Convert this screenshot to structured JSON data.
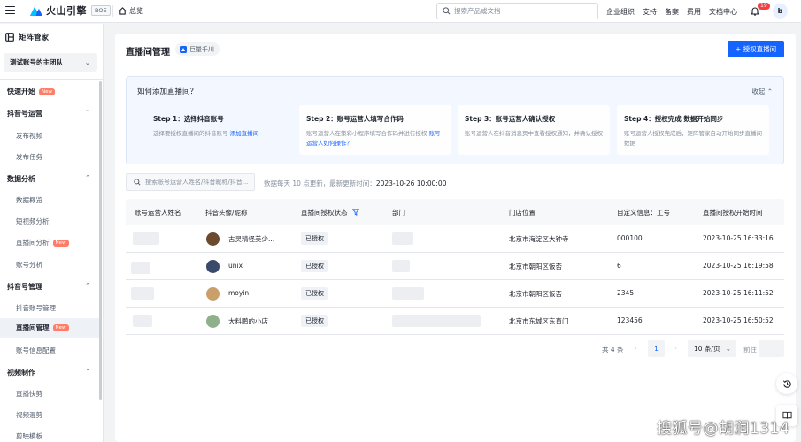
{
  "topbar": {
    "brand": "火山引擎",
    "env_badge": "BOE",
    "home_label": "总览",
    "search_placeholder": "搜索产品或文档",
    "nav": [
      "企业组织",
      "支持",
      "备案",
      "费用",
      "文档中心"
    ],
    "notification_count": "19",
    "avatar_initial": "b"
  },
  "sidebar": {
    "title": "矩阵管家",
    "team_select": "测试账号的主团队",
    "new_badge": "New",
    "groups": {
      "quick_start": "快速开始",
      "douyin_ops": "抖音号运营",
      "publish_video": "发布视频",
      "publish_task": "发布任务",
      "data_analysis": "数据分析",
      "data_overview": "数据概览",
      "short_video_analysis": "短视频分析",
      "live_analysis": "直播间分析",
      "account_analysis": "账号分析",
      "account_mgmt": "抖音号管理",
      "douyin_account_mgmt": "抖音账号管理",
      "live_room_mgmt": "直播间管理",
      "account_info_config": "账号信息配置",
      "video_production": "视频制作",
      "live_clip": "直播快剪",
      "video_mix": "视频混剪",
      "edit_template": "剪映模板"
    }
  },
  "main": {
    "title": "直播间管理",
    "tag": "巨量千川",
    "authorize_button": "+ 授权直播间",
    "guide": {
      "title": "如何添加直播间？",
      "collapse": "收起",
      "steps": [
        {
          "title": "Step 1：选择抖音账号",
          "desc": "选择要授权直播间的抖音账号",
          "link": "添加直播间"
        },
        {
          "title": "Step 2：账号运营人填写合作码",
          "desc": "账号运营人在策彩小程序填写合作码并进行授权",
          "link": "账号运营人如何操作？"
        },
        {
          "title": "Step 3：账号运营人确认授权",
          "desc": "账号运营人在抖音消息页中查看授权通知，并确认授权"
        },
        {
          "title": "Step 4：授权完成 数据开始同步",
          "desc": "账号运营人授权完成后，矩阵管家自动开始同步直播间数据"
        }
      ]
    },
    "filter_placeholder": "搜索账号运营人姓名/抖音昵称/抖音...",
    "update_note": "数据每天 10 点更新，最新更新时间：",
    "update_time": "2023-10-26 10:00:00",
    "table": {
      "headers": [
        "账号运营人姓名",
        "抖音头像/昵称",
        "直播间授权状态",
        "部门",
        "门店位置",
        "自定义信息：工号",
        "直播间授权开始时间"
      ],
      "rows": [
        {
          "nickname": "古灵精怪美少...",
          "status": "已授权",
          "location": "北京市海淀区大钟寺",
          "custom": "000100",
          "start_time": "2023-10-25 16:33:16",
          "avatar_color": "#6b4a2e"
        },
        {
          "nickname": "unix",
          "status": "已授权",
          "location": "北京市朝阳区饭否",
          "custom": "6",
          "start_time": "2023-10-25 16:19:58",
          "avatar_color": "#3b4a6b"
        },
        {
          "nickname": "moyin",
          "status": "已授权",
          "location": "北京市朝阳区饭否",
          "custom": "2345",
          "start_time": "2023-10-25 16:11:52",
          "avatar_color": "#c9a06a"
        },
        {
          "nickname": "大料鹏的小店",
          "status": "已授权",
          "location": "北京市东城区东直门",
          "custom": "123456",
          "start_time": "2023-10-25 16:50:52",
          "avatar_color": "#8fb08a"
        }
      ]
    },
    "pagination": {
      "total": "共 4 条",
      "current_page": "1",
      "page_size": "10 条/页",
      "goto": "前往"
    }
  },
  "watermark": "搜狐号@胡润1314",
  "colors": {
    "primary": "#1664ff",
    "new_badge": "#ff7d66",
    "notification": "#f53f3f"
  }
}
